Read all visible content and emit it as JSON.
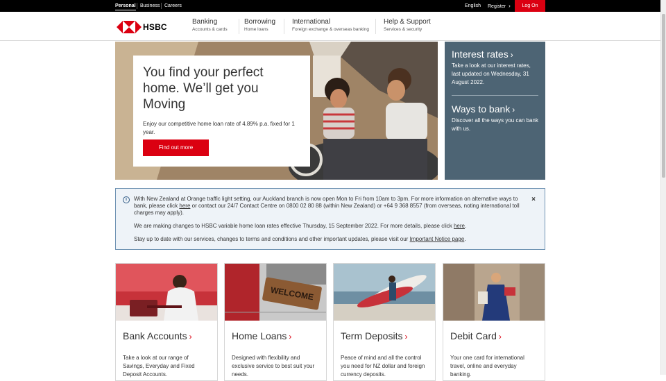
{
  "topbar": {
    "personal": "Personal",
    "business": "Business",
    "careers": "Careers",
    "english": "English",
    "register": "Register",
    "logon": "Log On"
  },
  "brand": {
    "name": "HSBC",
    "red": "#db0011",
    "panel": "#4d6474"
  },
  "nav": [
    {
      "title": "Banking",
      "sub": "Accounts & cards"
    },
    {
      "title": "Borrowing",
      "sub": "Home loans"
    },
    {
      "title": "International",
      "sub": "Foreign exchange & overseas banking"
    },
    {
      "title": "Help & Support",
      "sub": "Services & security"
    }
  ],
  "hero": {
    "heading": "You find your perfect home. We’ll get you Moving",
    "body": "Enjoy our competitive home loan rate of 4.89% p.a. fixed for 1 year.",
    "button": "Find out more"
  },
  "side": {
    "rates_title": "Interest rates",
    "rates_body": "Take a look at our interest rates, last updated on Wednesday, 31 August 2022.",
    "ways_title": "Ways to bank",
    "ways_body": "Discover all the ways you can bank with us."
  },
  "notice": {
    "p1_a": "With New Zealand at Orange traffic light setting, our Auckland branch is now open Mon to Fri from 10am to 3pm. For more information on alternative ways to bank, please click ",
    "p1_link": "here",
    "p1_b": " or contact our 24/7 Contact Centre on 0800 02 80 88 (within New Zealand) or +64 9 368 8557 (from overseas, noting international toll charges may apply).",
    "p2_a": "We are making changes to HSBC variable home loan rates effective Thursday, 15 September 2022. For more details, please click ",
    "p2_link": "here",
    "p2_b": ".",
    "p3_a": "Stay up to date with our services, changes to terms and conditions and other important updates, please visit our ",
    "p3_link": "Important Notice page",
    "p3_b": "."
  },
  "cards": [
    {
      "title": "Bank Accounts",
      "body": "Take a look at our range of Savings, Everyday and Fixed Deposit Accounts."
    },
    {
      "title": "Home Loans",
      "body": "Designed with flexibility and exclusive service to best suit your needs."
    },
    {
      "title": "Term Deposits",
      "body": "Peace of mind and all the control you need for NZ dollar and foreign currency deposits."
    },
    {
      "title": "Debit Card",
      "body": "Your one card for international travel, online and everyday banking."
    }
  ],
  "images": {
    "welcome_mat": "WELCOME"
  },
  "icons": {
    "info": "info-icon",
    "close": "close-icon",
    "chevron": "chevron-right-icon"
  }
}
